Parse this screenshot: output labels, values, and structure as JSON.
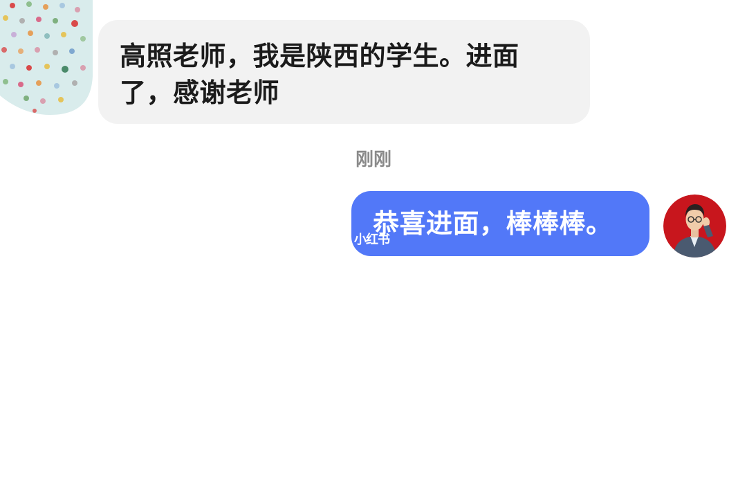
{
  "messages": {
    "incoming": {
      "text": "高照老师，我是陕西的学生。进面了，感谢老师",
      "avatar": "polka-dot-avatar"
    },
    "timestamp": "刚刚",
    "outgoing": {
      "text": "恭喜进面，棒棒棒。",
      "avatar": "teacher-photo-avatar"
    }
  },
  "watermark": "小红书",
  "colors": {
    "incoming_bubble": "#f2f2f2",
    "outgoing_bubble": "#5278f8",
    "timestamp_text": "#8a8a8a",
    "avatar_right_bg": "#c8161d"
  }
}
